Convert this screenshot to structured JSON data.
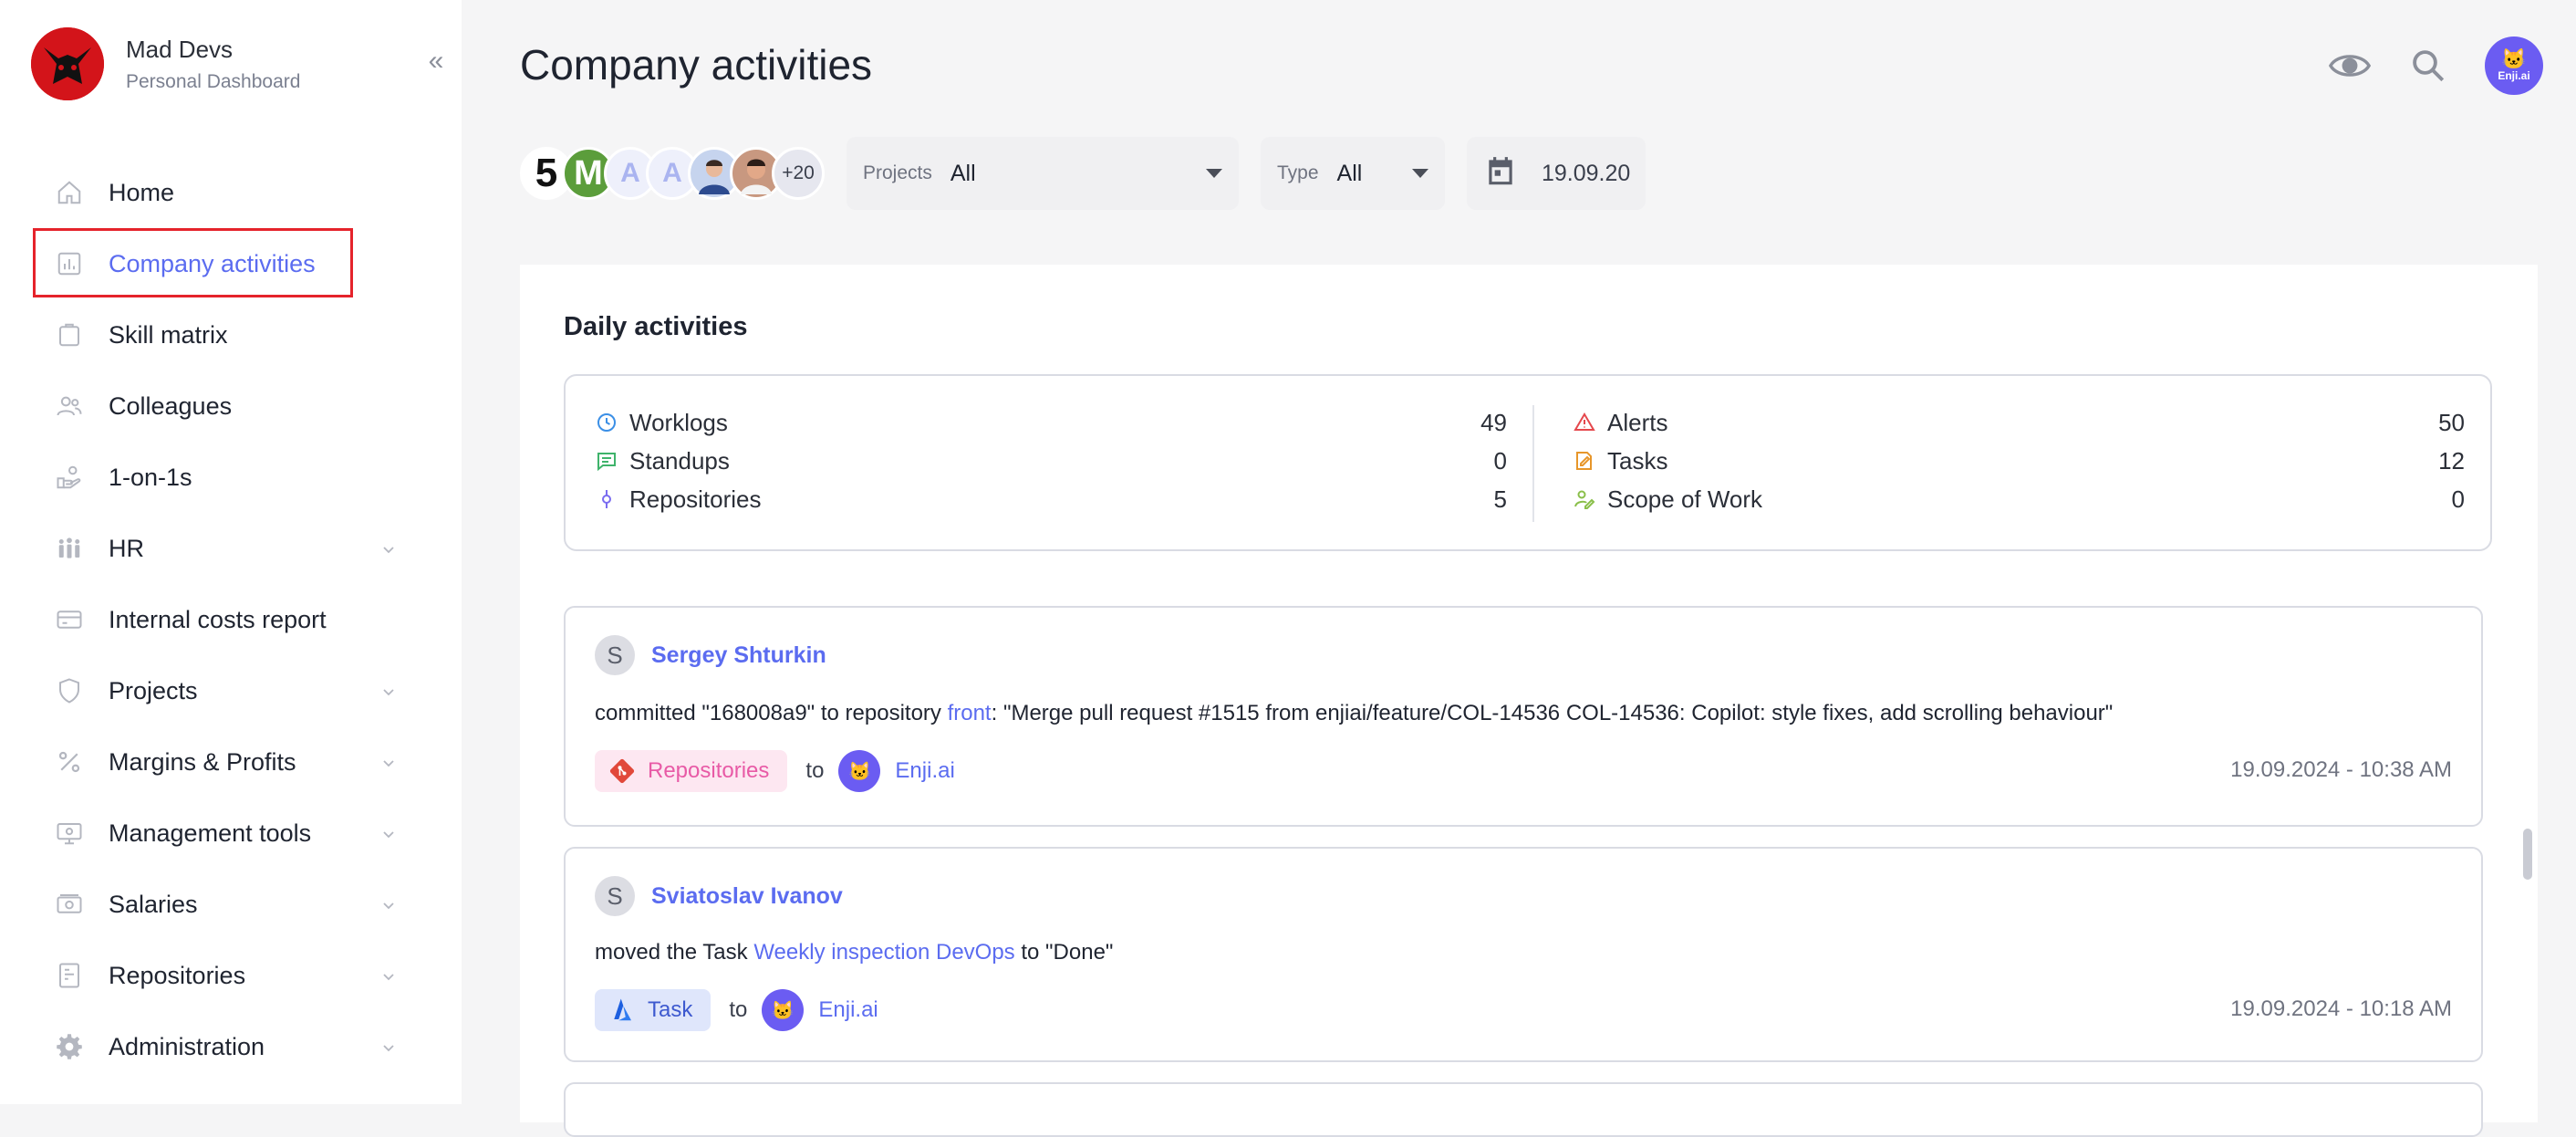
{
  "brand": {
    "name": "Mad Devs",
    "subtitle": "Personal Dashboard"
  },
  "sidebar": {
    "collapse_label": "«",
    "items": [
      {
        "label": "Home",
        "icon": "home-icon",
        "expandable": false
      },
      {
        "label": "Company activities",
        "icon": "chart-icon",
        "expandable": false,
        "active": true
      },
      {
        "label": "Skill matrix",
        "icon": "clipboard-icon",
        "expandable": false
      },
      {
        "label": "Colleagues",
        "icon": "people-icon",
        "expandable": false
      },
      {
        "label": "1-on-1s",
        "icon": "handshake-icon",
        "expandable": false
      },
      {
        "label": "HR",
        "icon": "team-icon",
        "expandable": true
      },
      {
        "label": "Internal costs report",
        "icon": "card-icon",
        "expandable": false
      },
      {
        "label": "Projects",
        "icon": "shield-icon",
        "expandable": true
      },
      {
        "label": "Margins & Profits",
        "icon": "percent-icon",
        "expandable": true
      },
      {
        "label": "Management tools",
        "icon": "monitor-icon",
        "expandable": true
      },
      {
        "label": "Salaries",
        "icon": "money-icon",
        "expandable": true
      },
      {
        "label": "Repositories",
        "icon": "repo-icon",
        "expandable": true
      },
      {
        "label": "Administration",
        "icon": "gear-icon",
        "expandable": true
      }
    ]
  },
  "header": {
    "title": "Company activities",
    "user_avatar_text": "Enji.ai"
  },
  "filters": {
    "faces": [
      "5",
      "M",
      "A",
      "A",
      "",
      ""
    ],
    "more_count": "+20",
    "projects_key": "Projects",
    "projects_value": "All",
    "type_key": "Type",
    "type_value": "All",
    "date_value": "19.09.20"
  },
  "daily": {
    "title": "Daily activities",
    "left": [
      {
        "label": "Worklogs",
        "value": "49",
        "icon": "clock-icon",
        "color": "#3b8fe6"
      },
      {
        "label": "Standups",
        "value": "0",
        "icon": "chat-icon",
        "color": "#3fb36b"
      },
      {
        "label": "Repositories",
        "value": "5",
        "icon": "commit-icon",
        "color": "#7a6cf0"
      }
    ],
    "right": [
      {
        "label": "Alerts",
        "value": "50",
        "icon": "warning-icon",
        "color": "#e5484d"
      },
      {
        "label": "Tasks",
        "value": "12",
        "icon": "edit-icon",
        "color": "#e7962a"
      },
      {
        "label": "Scope of Work",
        "value": "0",
        "icon": "scope-icon",
        "color": "#8abf4a"
      }
    ]
  },
  "activities": [
    {
      "avatar": "S",
      "user": "Sergey Shturkin",
      "msg_prefix": "committed \"168008a9\" to repository ",
      "msg_link": "front",
      "msg_suffix": ": \"Merge pull request #1515 from enjiai/feature/COL-14536 COL-14536: Copilot: style fixes, add scrolling behaviour\"",
      "tag": "Repositories",
      "to": "to",
      "project": "Enji.ai",
      "time": "19.09.2024 - 10:38 AM"
    },
    {
      "avatar": "S",
      "user": "Sviatoslav Ivanov",
      "msg_prefix": "moved the Task ",
      "msg_link": "Weekly inspection DevOps",
      "msg_suffix": " to \"Done\"",
      "tag": "Task",
      "to": "to",
      "project": "Enji.ai",
      "time": "19.09.2024 - 10:18 AM"
    }
  ],
  "colors": {
    "accent": "#5b6cf0",
    "highlight_border": "#e5232b"
  }
}
